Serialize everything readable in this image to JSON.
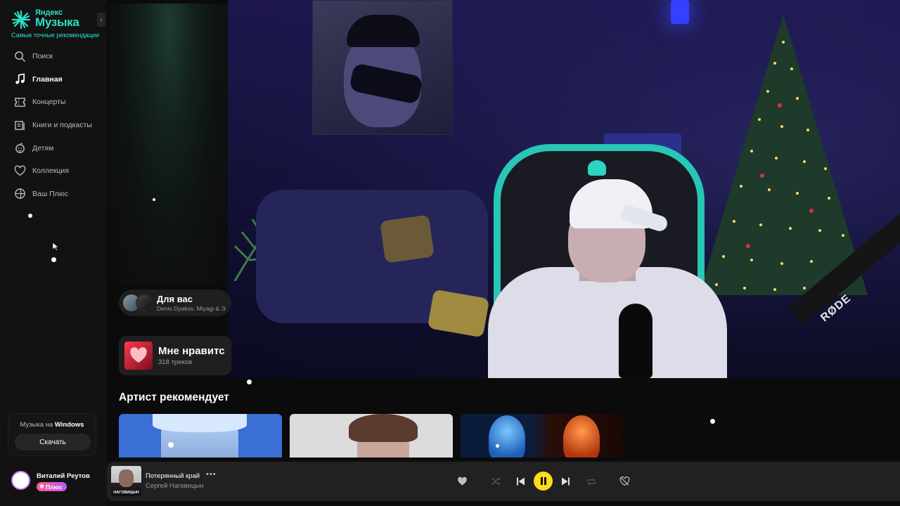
{
  "brand": {
    "logo_small": "Яндекс",
    "logo_big": "Музыка",
    "tagline": "Самые точные рекомендации"
  },
  "nav": {
    "items": [
      {
        "label": "Поиск",
        "icon": "search-icon"
      },
      {
        "label": "Главная",
        "icon": "music-note-icon",
        "active": true
      },
      {
        "label": "Концерты",
        "icon": "ticket-icon"
      },
      {
        "label": "Книги и подкасты",
        "icon": "book-icon"
      },
      {
        "label": "Детям",
        "icon": "kids-icon"
      },
      {
        "label": "Коллекция",
        "icon": "heart-icon"
      },
      {
        "label": "Ваш Плюс",
        "icon": "plus-circle-icon"
      }
    ]
  },
  "download": {
    "title_prefix": "Музыка на",
    "title_platform": "Windows",
    "button": "Скачать"
  },
  "user": {
    "name": "Виталий Реутов",
    "badge": "Плюс"
  },
  "cards": {
    "for_you": {
      "title": "Для вас",
      "subtitle": "Denis Dyakov, Miyagi & Э"
    },
    "likes": {
      "title": "Мне нравитс",
      "subtitle": "318 треков"
    }
  },
  "artist_section": {
    "title": "Артист рекомендует"
  },
  "webcam": {
    "mic_brand": "RØDE"
  },
  "player": {
    "track_title": "Потерянный край",
    "artist": "Сергей Наговицын",
    "cover_text": "НАГОВИЦЫН",
    "more": "•••",
    "state": "playing"
  },
  "colors": {
    "accent": "#2fe0c4",
    "play_button": "#ffdb1a",
    "sidebar_bg": "#121212",
    "player_bg": "#212121"
  }
}
